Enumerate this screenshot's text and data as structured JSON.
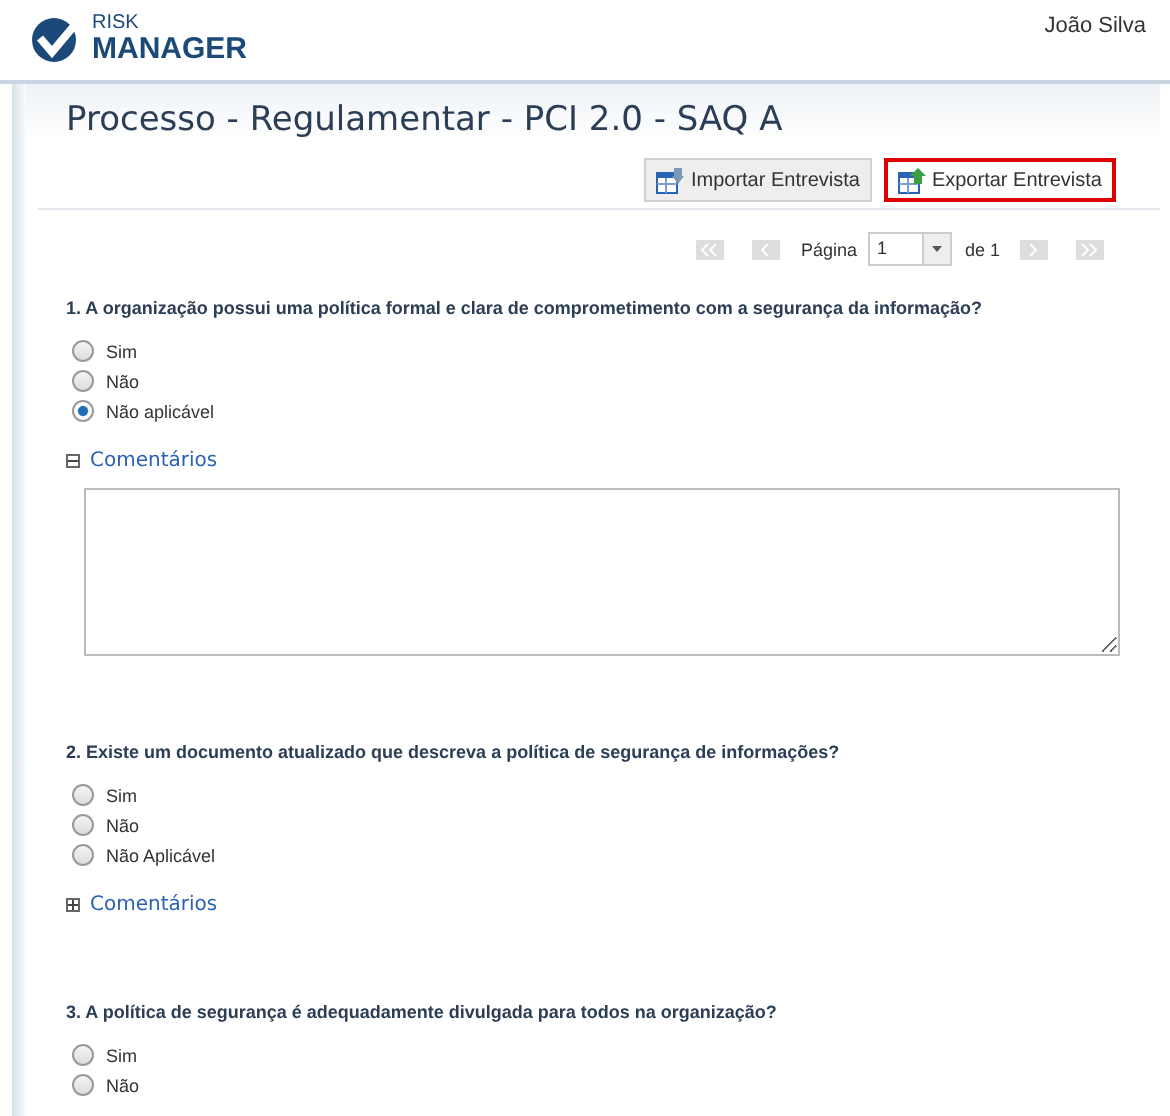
{
  "header": {
    "logo_top": "RISK",
    "logo_bottom": "MANAGER",
    "user": "João Silva"
  },
  "title": "Processo - Regulamentar - PCI 2.0 - SAQ A",
  "actions": [
    {
      "label": "Importar Entrevista",
      "kind": "import",
      "highlighted": false
    },
    {
      "label": "Exportar Entrevista",
      "kind": "export",
      "highlighted": true
    }
  ],
  "pager": {
    "label": "Página",
    "page": "1",
    "of": "de 1"
  },
  "questions": [
    {
      "text": "1. A organização possui uma política formal e clara de comprometimento com a segurança da informação?",
      "options": [
        {
          "label": "Sim",
          "selected": false
        },
        {
          "label": "Não",
          "selected": false
        },
        {
          "label": "Não aplicável",
          "selected": true
        }
      ],
      "comments": {
        "label": "Comentários",
        "expanded": true
      }
    },
    {
      "text": "2. Existe um documento atualizado que descreva a política de segurança de informações?",
      "options": [
        {
          "label": "Sim",
          "selected": false
        },
        {
          "label": "Não",
          "selected": false
        },
        {
          "label": "Não Aplicável",
          "selected": false
        }
      ],
      "comments": {
        "label": "Comentários",
        "expanded": false
      }
    },
    {
      "text": "3. A política de segurança é adequadamente divulgada para todos na organização?",
      "options": [
        {
          "label": "Sim",
          "selected": false
        },
        {
          "label": "Não",
          "selected": false
        }
      ]
    }
  ]
}
